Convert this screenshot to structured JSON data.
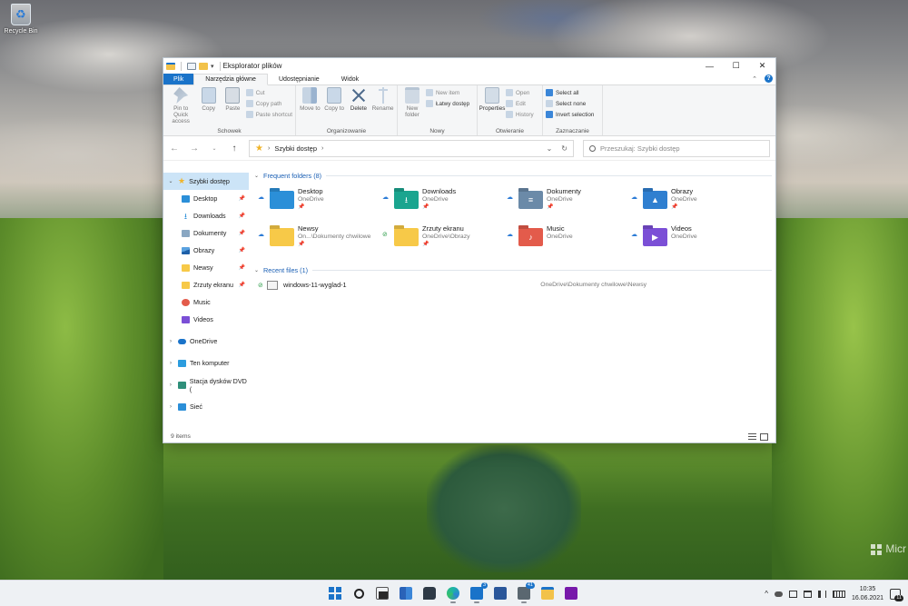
{
  "desktop": {
    "recycle_bin_label": "Recycle Bin",
    "watermark": "Micr"
  },
  "window": {
    "title": "Eksplorator plików",
    "controls": {
      "minimize": "—",
      "maximize": "☐",
      "close": "✕"
    }
  },
  "tabs": [
    {
      "label": "Plik"
    },
    {
      "label": "Narzędzia główne"
    },
    {
      "label": "Udostępnianie"
    },
    {
      "label": "Widok"
    }
  ],
  "ribbon": {
    "schowek": {
      "label": "Schowek",
      "pin": "Pin to Quick access",
      "copy": "Copy",
      "paste": "Paste",
      "cut": "Cut",
      "copy_path": "Copy path",
      "paste_shortcut": "Paste shortcut"
    },
    "organizowanie": {
      "label": "Organizowanie",
      "move_to": "Move to",
      "copy_to": "Copy to",
      "delete": "Delete",
      "rename": "Rename"
    },
    "nowy": {
      "label": "Nowy",
      "new_folder": "New folder",
      "new_item": "New item",
      "easy_access": "Łatwy dostęp"
    },
    "otwieranie": {
      "label": "Otwieranie",
      "properties": "Properties",
      "open": "Open",
      "edit": "Edit",
      "history": "History"
    },
    "zaznaczanie": {
      "label": "Zaznaczanie",
      "select_all": "Select all",
      "select_none": "Select none",
      "invert_selection": "Invert selection"
    }
  },
  "address": {
    "path": "Szybki dostęp",
    "search_placeholder": "Przeszukaj: Szybki dostęp"
  },
  "nav": {
    "quick_access": "Szybki dostęp",
    "pinned": [
      {
        "label": "Desktop"
      },
      {
        "label": "Downloads"
      },
      {
        "label": "Dokumenty"
      },
      {
        "label": "Obrazy"
      },
      {
        "label": "Newsy"
      },
      {
        "label": "Zrzuty ekranu"
      },
      {
        "label": "Music"
      },
      {
        "label": "Videos"
      }
    ],
    "onedrive": "OneDrive",
    "this_pc": "Ten komputer",
    "dvd": "Stacja dysków DVD (",
    "network": "Sieć"
  },
  "frequent": {
    "header": "Frequent folders (8)",
    "folders": [
      {
        "name": "Desktop",
        "sub": "OneDrive",
        "color": "#2b8fd8",
        "glyph": ""
      },
      {
        "name": "Downloads",
        "sub": "OneDrive",
        "color": "#1aa58f",
        "glyph": "⭳"
      },
      {
        "name": "Dokumenty",
        "sub": "OneDrive",
        "color": "#6b8aa8",
        "glyph": "≡"
      },
      {
        "name": "Obrazy",
        "sub": "OneDrive",
        "color": "#2f7fd0",
        "glyph": "▲"
      },
      {
        "name": "Newsy",
        "sub": "On...\\Dokumenty chwilowe",
        "color": "#f7c948",
        "glyph": ""
      },
      {
        "name": "Zrzuty ekranu",
        "sub": "OneDrive\\Obrazy",
        "color": "#f7c948",
        "glyph": ""
      },
      {
        "name": "Music",
        "sub": "OneDrive",
        "color": "#e35b4b",
        "glyph": "♪"
      },
      {
        "name": "Videos",
        "sub": "OneDrive",
        "color": "#7b4fd6",
        "glyph": "▶"
      }
    ]
  },
  "recent": {
    "header": "Recent files (1)",
    "files": [
      {
        "name": "windows-11-wyglad-1",
        "path": "OneDrive\\Dokumenty chwilowe\\Newsy"
      }
    ]
  },
  "status": {
    "count": "9 items"
  },
  "taskbar": {
    "mail_badge": "3",
    "calc_badge": "41",
    "time": "10:35",
    "date": "16.06.2021",
    "notifications": "11"
  }
}
